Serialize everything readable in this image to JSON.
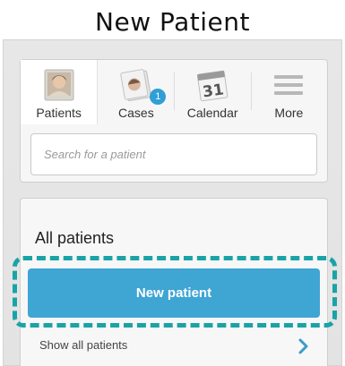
{
  "heading": "New Patient",
  "tabs": [
    {
      "label": "Patients",
      "icon": "patient-photo-icon",
      "active": true
    },
    {
      "label": "Cases",
      "icon": "cases-icon",
      "badge": "1"
    },
    {
      "label": "Calendar",
      "icon": "calendar-icon",
      "icon_text": "31"
    },
    {
      "label": "More",
      "icon": "menu-lines-icon"
    }
  ],
  "search": {
    "placeholder": "Search for a patient"
  },
  "patients_card": {
    "title": "All patients",
    "new_button": "New patient",
    "show_all": "Show all patients"
  },
  "colors": {
    "accent": "#3fa5d3",
    "highlight": "#1aa3a6",
    "badge": "#2f9fd5"
  }
}
